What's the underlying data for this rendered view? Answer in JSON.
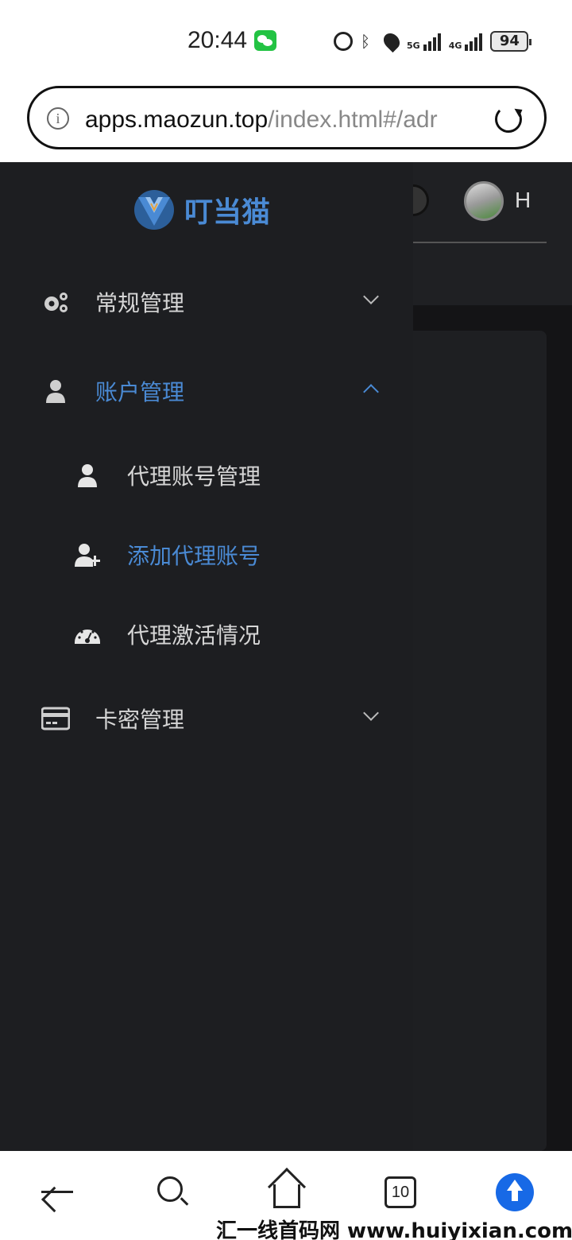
{
  "status_bar": {
    "time": "20:44",
    "network_1": "5G",
    "network_2": "4G",
    "battery": "94"
  },
  "browser": {
    "url_host": "apps.maozun.top",
    "url_path": "/index.html#/adr"
  },
  "app": {
    "logo_text": "叮当猫",
    "user_initial": "H",
    "accent_color": "#4a8ad4",
    "sidebar_bg": "#1d1e21"
  },
  "sidebar": {
    "items": [
      {
        "label": "常规管理",
        "icon": "gears-icon",
        "expanded": false,
        "active": false
      },
      {
        "label": "账户管理",
        "icon": "user-icon",
        "expanded": true,
        "active": true
      },
      {
        "label": "代理账号管理",
        "icon": "user-icon",
        "sub": true,
        "active": false
      },
      {
        "label": "添加代理账号",
        "icon": "user-plus-icon",
        "sub": true,
        "active": true
      },
      {
        "label": "代理激活情况",
        "icon": "dashboard-gauge-icon",
        "sub": true,
        "active": false
      },
      {
        "label": "卡密管理",
        "icon": "credit-card-icon",
        "expanded": false,
        "active": false
      }
    ]
  },
  "bottom_nav": {
    "tabs_count": "10",
    "watermark": "汇一线首码网 www.huiyixian.com"
  }
}
